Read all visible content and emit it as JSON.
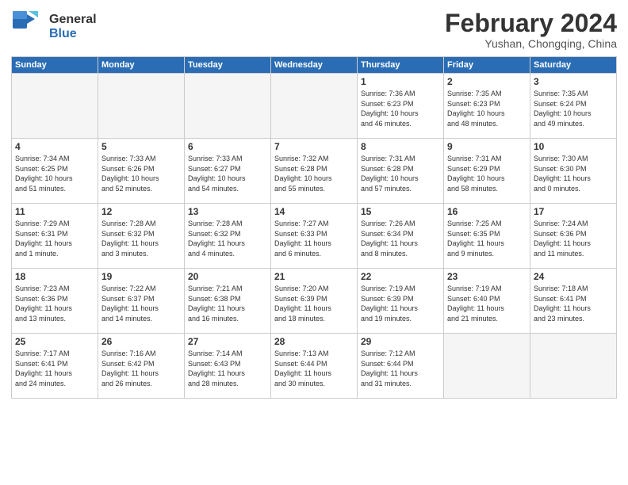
{
  "logo": {
    "general": "General",
    "blue": "Blue"
  },
  "title": {
    "month_year": "February 2024",
    "location": "Yushan, Chongqing, China"
  },
  "weekdays": [
    "Sunday",
    "Monday",
    "Tuesday",
    "Wednesday",
    "Thursday",
    "Friday",
    "Saturday"
  ],
  "weeks": [
    [
      {
        "day": "",
        "info": ""
      },
      {
        "day": "",
        "info": ""
      },
      {
        "day": "",
        "info": ""
      },
      {
        "day": "",
        "info": ""
      },
      {
        "day": "1",
        "info": "Sunrise: 7:36 AM\nSunset: 6:23 PM\nDaylight: 10 hours\nand 46 minutes."
      },
      {
        "day": "2",
        "info": "Sunrise: 7:35 AM\nSunset: 6:23 PM\nDaylight: 10 hours\nand 48 minutes."
      },
      {
        "day": "3",
        "info": "Sunrise: 7:35 AM\nSunset: 6:24 PM\nDaylight: 10 hours\nand 49 minutes."
      }
    ],
    [
      {
        "day": "4",
        "info": "Sunrise: 7:34 AM\nSunset: 6:25 PM\nDaylight: 10 hours\nand 51 minutes."
      },
      {
        "day": "5",
        "info": "Sunrise: 7:33 AM\nSunset: 6:26 PM\nDaylight: 10 hours\nand 52 minutes."
      },
      {
        "day": "6",
        "info": "Sunrise: 7:33 AM\nSunset: 6:27 PM\nDaylight: 10 hours\nand 54 minutes."
      },
      {
        "day": "7",
        "info": "Sunrise: 7:32 AM\nSunset: 6:28 PM\nDaylight: 10 hours\nand 55 minutes."
      },
      {
        "day": "8",
        "info": "Sunrise: 7:31 AM\nSunset: 6:28 PM\nDaylight: 10 hours\nand 57 minutes."
      },
      {
        "day": "9",
        "info": "Sunrise: 7:31 AM\nSunset: 6:29 PM\nDaylight: 10 hours\nand 58 minutes."
      },
      {
        "day": "10",
        "info": "Sunrise: 7:30 AM\nSunset: 6:30 PM\nDaylight: 11 hours\nand 0 minutes."
      }
    ],
    [
      {
        "day": "11",
        "info": "Sunrise: 7:29 AM\nSunset: 6:31 PM\nDaylight: 11 hours\nand 1 minute."
      },
      {
        "day": "12",
        "info": "Sunrise: 7:28 AM\nSunset: 6:32 PM\nDaylight: 11 hours\nand 3 minutes."
      },
      {
        "day": "13",
        "info": "Sunrise: 7:28 AM\nSunset: 6:32 PM\nDaylight: 11 hours\nand 4 minutes."
      },
      {
        "day": "14",
        "info": "Sunrise: 7:27 AM\nSunset: 6:33 PM\nDaylight: 11 hours\nand 6 minutes."
      },
      {
        "day": "15",
        "info": "Sunrise: 7:26 AM\nSunset: 6:34 PM\nDaylight: 11 hours\nand 8 minutes."
      },
      {
        "day": "16",
        "info": "Sunrise: 7:25 AM\nSunset: 6:35 PM\nDaylight: 11 hours\nand 9 minutes."
      },
      {
        "day": "17",
        "info": "Sunrise: 7:24 AM\nSunset: 6:36 PM\nDaylight: 11 hours\nand 11 minutes."
      }
    ],
    [
      {
        "day": "18",
        "info": "Sunrise: 7:23 AM\nSunset: 6:36 PM\nDaylight: 11 hours\nand 13 minutes."
      },
      {
        "day": "19",
        "info": "Sunrise: 7:22 AM\nSunset: 6:37 PM\nDaylight: 11 hours\nand 14 minutes."
      },
      {
        "day": "20",
        "info": "Sunrise: 7:21 AM\nSunset: 6:38 PM\nDaylight: 11 hours\nand 16 minutes."
      },
      {
        "day": "21",
        "info": "Sunrise: 7:20 AM\nSunset: 6:39 PM\nDaylight: 11 hours\nand 18 minutes."
      },
      {
        "day": "22",
        "info": "Sunrise: 7:19 AM\nSunset: 6:39 PM\nDaylight: 11 hours\nand 19 minutes."
      },
      {
        "day": "23",
        "info": "Sunrise: 7:19 AM\nSunset: 6:40 PM\nDaylight: 11 hours\nand 21 minutes."
      },
      {
        "day": "24",
        "info": "Sunrise: 7:18 AM\nSunset: 6:41 PM\nDaylight: 11 hours\nand 23 minutes."
      }
    ],
    [
      {
        "day": "25",
        "info": "Sunrise: 7:17 AM\nSunset: 6:41 PM\nDaylight: 11 hours\nand 24 minutes."
      },
      {
        "day": "26",
        "info": "Sunrise: 7:16 AM\nSunset: 6:42 PM\nDaylight: 11 hours\nand 26 minutes."
      },
      {
        "day": "27",
        "info": "Sunrise: 7:14 AM\nSunset: 6:43 PM\nDaylight: 11 hours\nand 28 minutes."
      },
      {
        "day": "28",
        "info": "Sunrise: 7:13 AM\nSunset: 6:44 PM\nDaylight: 11 hours\nand 30 minutes."
      },
      {
        "day": "29",
        "info": "Sunrise: 7:12 AM\nSunset: 6:44 PM\nDaylight: 11 hours\nand 31 minutes."
      },
      {
        "day": "",
        "info": ""
      },
      {
        "day": "",
        "info": ""
      }
    ]
  ]
}
